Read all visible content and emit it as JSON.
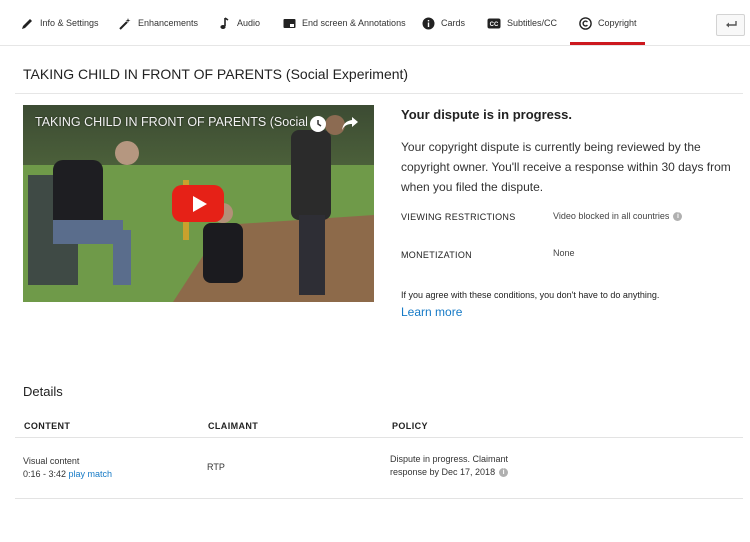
{
  "tabs": [
    {
      "label": "Info & Settings",
      "icon": "pencil-icon"
    },
    {
      "label": "Enhancements",
      "icon": "magic-wand-icon"
    },
    {
      "label": "Audio",
      "icon": "music-note-icon"
    },
    {
      "label": "End screen & Annotations",
      "icon": "end-screen-icon"
    },
    {
      "label": "Cards",
      "icon": "info-icon"
    },
    {
      "label": "Subtitles/CC",
      "icon": "cc-icon"
    },
    {
      "label": "Copyright",
      "icon": "copyright-icon",
      "active": true
    }
  ],
  "back_icon": "back-arrow-icon",
  "video": {
    "title": "TAKING CHILD IN FRONT OF PARENTS (Social Experiment)",
    "thumbnail_title": "TAKING CHILD IN FRONT OF PARENTS (Social Experiment)"
  },
  "dispute": {
    "heading": "Your dispute is in progress.",
    "text": "Your copyright dispute is currently being reviewed by the copyright owner. You'll receive a response within 30 days from when you filed the dispute.",
    "viewing_label": "VIEWING RESTRICTIONS",
    "viewing_value": "Video blocked in all countries",
    "monetization_label": "MONETIZATION",
    "monetization_value": "None",
    "agree_text": "If you agree with these conditions, you don't have to do anything.",
    "learn_more": "Learn more"
  },
  "details": {
    "heading": "Details",
    "columns": {
      "content": "CONTENT",
      "claimant": "CLAIMANT",
      "policy": "POLICY"
    },
    "row": {
      "content_line1": "Visual content",
      "content_range": "0:16 - 3:42",
      "play_match": "play match",
      "claimant": "RTP",
      "policy_line1": "Dispute in progress. Claimant",
      "policy_line2": "response by Dec 17, 2018"
    }
  },
  "colors": {
    "accent_red": "#cc181e",
    "link_blue": "#167ac6",
    "play_red": "#e62117"
  }
}
